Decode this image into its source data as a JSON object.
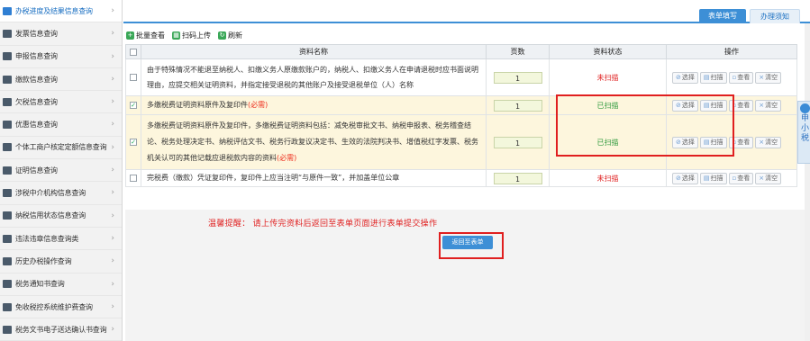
{
  "sidebar": {
    "items": [
      {
        "label": "办税进度及结果信息查询",
        "icon": "progress-icon"
      },
      {
        "label": "发票信息查询",
        "icon": "invoice-icon"
      },
      {
        "label": "申报信息查询",
        "icon": "declare-icon"
      },
      {
        "label": "缴款信息查询",
        "icon": "payment-icon"
      },
      {
        "label": "欠税信息查询",
        "icon": "arrears-icon"
      },
      {
        "label": "优惠信息查询",
        "icon": "discount-icon"
      },
      {
        "label": "个体工商户核定定额信息查询",
        "icon": "business-icon"
      },
      {
        "label": "证明信息查询",
        "icon": "certificate-icon"
      },
      {
        "label": "涉税中介机构信息查询",
        "icon": "agency-icon"
      },
      {
        "label": "纳税信用状态信息查询",
        "icon": "credit-icon"
      },
      {
        "label": "违法违章信息查询类",
        "icon": "violation-icon"
      },
      {
        "label": "历史办税操作查询",
        "icon": "history-icon"
      },
      {
        "label": "税务通知书查询",
        "icon": "notice-icon"
      },
      {
        "label": "免收税控系统维护费查询",
        "icon": "maintenance-icon"
      },
      {
        "label": "税务文书电子送达确认书查询",
        "icon": "document-icon"
      }
    ]
  },
  "tabs": [
    {
      "label": "表单填写"
    },
    {
      "label": "办理须知"
    }
  ],
  "toolbar": {
    "batch_view": "批量查看",
    "scan_upload": "扫码上传",
    "refresh": "刷新"
  },
  "table": {
    "headers": {
      "name": "资料名称",
      "pages": "页数",
      "status": "资料状态",
      "ops": "操作"
    },
    "ops": {
      "select": "选择",
      "scan": "扫描",
      "view": "查看",
      "clear": "清空"
    },
    "rows": [
      {
        "checked": false,
        "name": "由于特殊情况不能退至纳税人、扣缴义务人原缴款账户的，纳税人、扣缴义务人在申请退税时应书面说明理由，应提交相关证明资料，并指定接受退税的其他账户及接受退税单位（人）名称",
        "required": "",
        "pages": "1",
        "status": "未扫描",
        "status_color": "#e02020"
      },
      {
        "checked": true,
        "name": "多缴税费证明资料原件及复印件",
        "required": "(必需)",
        "pages": "1",
        "status": "已扫描",
        "status_color": "#2f9a3d"
      },
      {
        "checked": true,
        "name": "多缴税费证明资料原件及复印件，多缴税费证明资料包括：减免税审批文书、纳税申报表、税务稽查结论、税务处理决定书、纳税评估文书、税务行政复议决定书、生效的法院判决书、增值税红字发票、税务机关认可的其他记载应退税款内容的资料",
        "required": "(必需)",
        "pages": "1",
        "status": "已扫描",
        "status_color": "#2f9a3d"
      },
      {
        "checked": false,
        "name": "完税费（缴款）凭证复印件，复印件上应当注明“与原件一致”，并加盖单位公章",
        "required": "",
        "pages": "1",
        "status": "未扫描",
        "status_color": "#e02020"
      }
    ]
  },
  "tip": "温馨提醒：  请上传完资料后返回至表单页面进行表单提交操作",
  "back_button": "返回至表单",
  "helper": "申小税"
}
